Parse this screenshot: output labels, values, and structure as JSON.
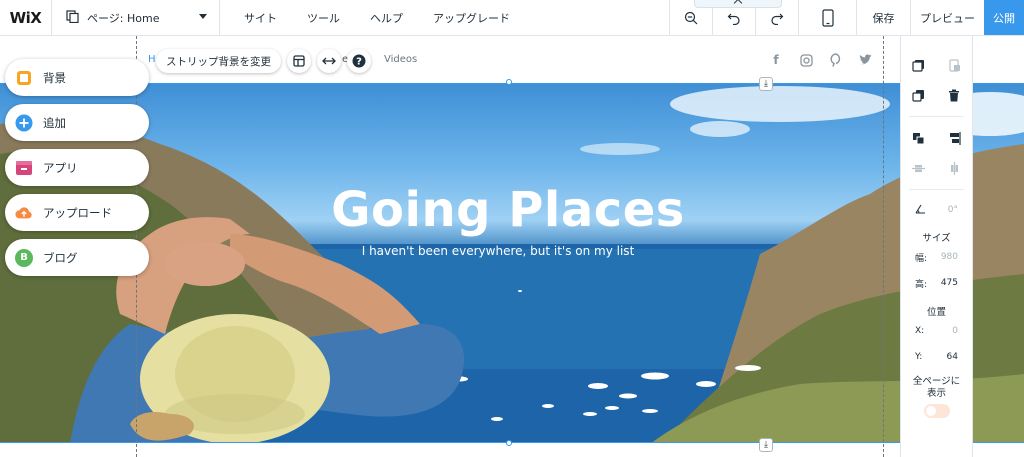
{
  "app": {
    "logo": "WiX",
    "accent": "#3899ec"
  },
  "topbar": {
    "page_select": "ページ: Home",
    "nav": [
      "サイト",
      "ツール",
      "ヘルプ",
      "アップグレード"
    ],
    "save": "保存",
    "preview": "プレビュー",
    "publish": "公開",
    "icons": [
      "zoom-out-icon",
      "undo-icon",
      "redo-icon",
      "mobile-view-icon"
    ]
  },
  "strip": {
    "home_fragment": "H",
    "menu_fragment": "e",
    "change_bg": "ストリップ背景を変更",
    "videos": "Videos",
    "social_icons": [
      "facebook-icon",
      "instagram-icon",
      "pinterest-icon",
      "twitter-icon"
    ]
  },
  "left_panel": [
    {
      "label": "背景",
      "icon": "background-icon",
      "color": "#f5a623"
    },
    {
      "label": "追加",
      "icon": "add-icon",
      "color": "#3899ec"
    },
    {
      "label": "アプリ",
      "icon": "app-market-icon",
      "color": "#d6457a"
    },
    {
      "label": "アップロード",
      "icon": "upload-icon",
      "color": "#f58a42"
    },
    {
      "label": "ブログ",
      "icon": "blog-icon",
      "color": "#5cb85c",
      "icon_text": "B"
    }
  ],
  "hero": {
    "title": "Going Places",
    "subtitle": "I haven't been everywhere, but it's on my list"
  },
  "inspector": {
    "angle": "0°",
    "size_label": "サイズ",
    "width_label": "幅:",
    "width_value": "980",
    "height_label": "高:",
    "height_value": "475",
    "position_label": "位置",
    "x_label": "X:",
    "x_value": "0",
    "y_label": "Y:",
    "y_value": "64",
    "show_all_pages_line1": "全ページに",
    "show_all_pages_line2": "表示"
  }
}
